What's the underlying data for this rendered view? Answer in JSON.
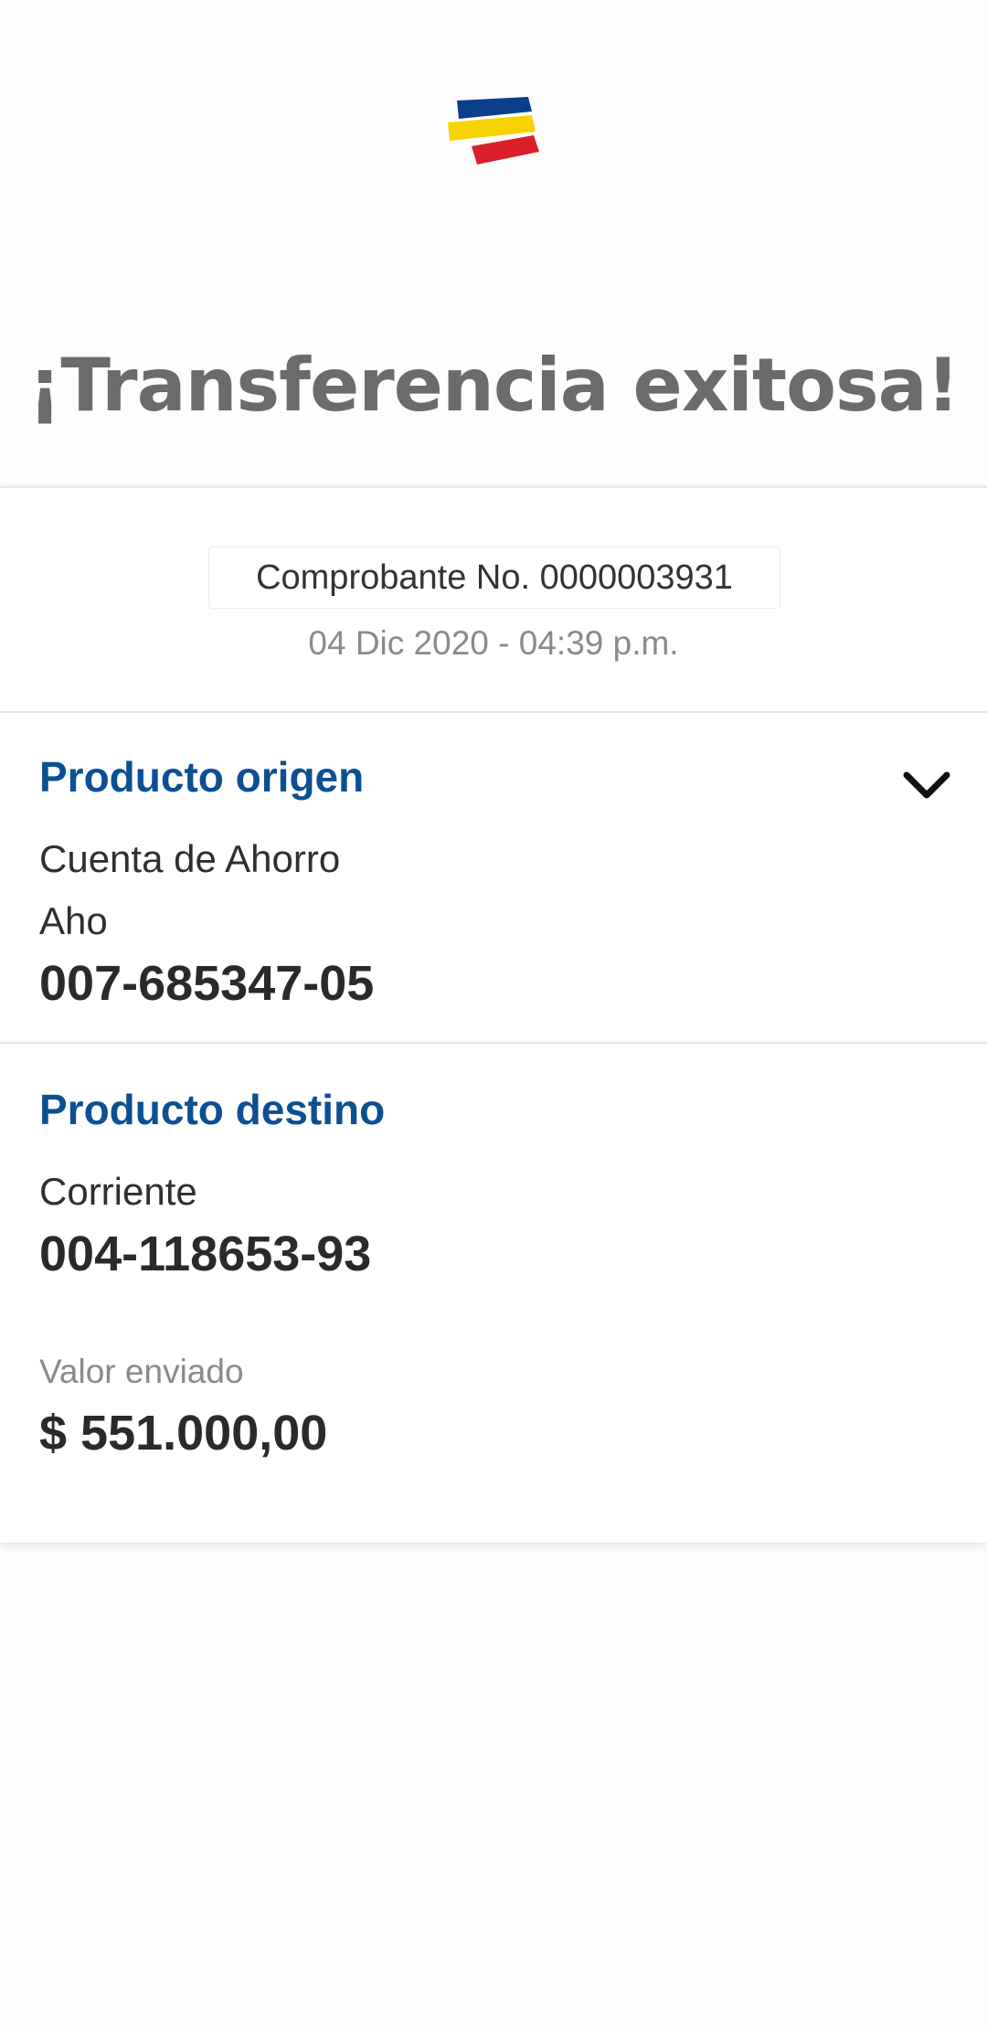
{
  "header": {
    "logo_icon": "bank-flag-logo",
    "logo_colors": [
      "#0b3f8c",
      "#f6d300",
      "#d9202b"
    ],
    "title": "¡Transferencia exitosa!"
  },
  "receipt": {
    "number_text": "Comprobante No. 0000003931",
    "datetime": "04 Dic 2020 - 04:39 p.m."
  },
  "origin": {
    "section_title": "Producto origen",
    "account_type": "Cuenta de Ahorro",
    "account_short": "Aho",
    "account_number": "007-685347-05",
    "toggle_icon": "chevron-down-icon"
  },
  "destination": {
    "section_title": "Producto destino",
    "account_type": "Corriente",
    "account_number": "004-118653-93"
  },
  "amount": {
    "label": "Valor enviado",
    "value": "$ 551.000,00"
  },
  "colors": {
    "accent_blue": "#0d4f93",
    "title_gray": "#6b6b6b"
  }
}
